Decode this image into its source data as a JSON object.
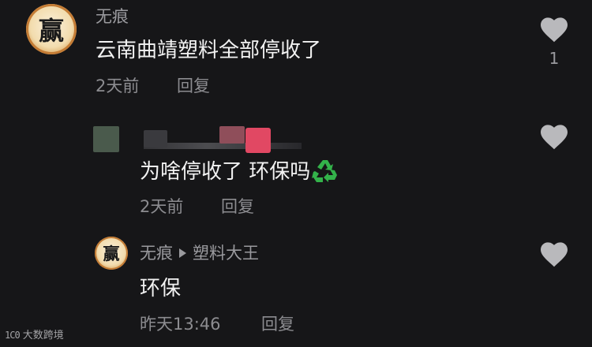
{
  "comments": [
    {
      "username": "无痕",
      "avatar_glyph": "赢",
      "text": "云南曲靖塑料全部停收了",
      "date": "2天前",
      "reply_label": "回复",
      "likes": "1"
    },
    {
      "username_obscured": true,
      "text": "为啥停收了 环保吗",
      "date": "2天前",
      "reply_label": "回复",
      "emoji": "recycle-icon"
    },
    {
      "username": "无痕",
      "avatar_glyph": "赢",
      "reply_to": "塑料大王",
      "text": "环保",
      "date": "昨天13:46",
      "reply_label": "回复"
    }
  ],
  "watermark": {
    "logo": "1C0",
    "text": "大数跨境"
  },
  "colors": {
    "background": "#161618",
    "heart": "#b9b9bc",
    "recycle": "#33b24a"
  }
}
